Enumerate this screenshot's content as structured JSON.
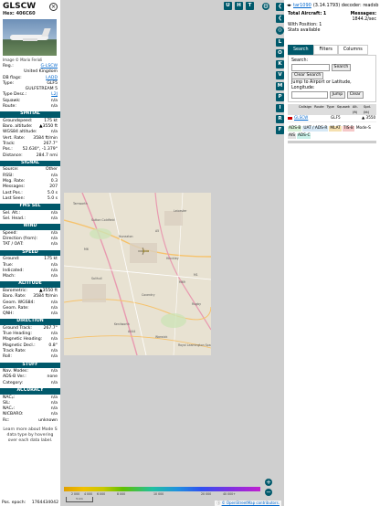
{
  "infoblock": {
    "callsign": "GLSCW",
    "hex_label": "Hex:",
    "hex": "406C60",
    "photo_credit": "Image © Mario Ferioli",
    "basic": [
      {
        "k": "Reg.:",
        "v": "G-LSCW",
        "link": true
      },
      {
        "k": "",
        "v": "United Kingdom",
        "link": false
      },
      {
        "k": "DB flags:",
        "v": "LADD",
        "link": true
      },
      {
        "k": "Type:",
        "v": "GLF5",
        "link": false
      },
      {
        "k": "",
        "v": "GULFSTREAM 5",
        "link": false
      },
      {
        "k": "Type Desc.:",
        "v": "L2J",
        "link": true
      },
      {
        "k": "Squawk:",
        "v": "n/a",
        "link": false
      },
      {
        "k": "Route:",
        "v": "n/a",
        "link": false
      }
    ],
    "spatial_title": "SPATIAL",
    "spatial": [
      {
        "k": "Groundspeed:",
        "v": "175 kt"
      },
      {
        "k": "Baro. altitude:",
        "v": "▲3550 ft"
      },
      {
        "k": "WGS84 altitude:",
        "v": "n/a"
      },
      {
        "k": "Vert. Rate:",
        "v": "3584 ft/min"
      },
      {
        "k": "Track:",
        "v": "267.7°"
      },
      {
        "k": "Pos.:",
        "v": "52.630°, -1.379°"
      },
      {
        "k": "Distance:",
        "v": "284.7 nmi"
      }
    ],
    "signal_title": "SIGNAL",
    "signal": [
      {
        "k": "Source:",
        "v": "Other"
      },
      {
        "k": "RSSI:",
        "v": "n/a"
      },
      {
        "k": "Msg. Rate:",
        "v": "0.3"
      },
      {
        "k": "Messages:",
        "v": "207"
      },
      {
        "k": "Last Pos.:",
        "v": "5.0 s"
      },
      {
        "k": "Last Seen:",
        "v": "5.0 s"
      }
    ],
    "fms_title": "FMS SEL",
    "fms": [
      {
        "k": "Sel. Alt.:",
        "v": "n/a"
      },
      {
        "k": "Sel. Head.:",
        "v": "n/a"
      }
    ],
    "wind_title": "WIND",
    "wind": [
      {
        "k": "Speed:",
        "v": "n/a"
      },
      {
        "k": "Direction (from):",
        "v": "n/a"
      },
      {
        "k": "TAT / OAT:",
        "v": "n/a"
      }
    ],
    "speed_title": "SPEED",
    "speed": [
      {
        "k": "Ground:",
        "v": "175 kt"
      },
      {
        "k": "True:",
        "v": "n/a"
      },
      {
        "k": "Indicated:",
        "v": "n/a"
      },
      {
        "k": "Mach:",
        "v": "n/a"
      }
    ],
    "altitude_title": "ALTITUDE",
    "altitude": [
      {
        "k": "Barometric:",
        "v": "▲3550 ft"
      },
      {
        "k": "Baro. Rate:",
        "v": "3584 ft/min"
      },
      {
        "k": "Geom. WGS84:",
        "v": "n/a"
      },
      {
        "k": "Geom. Rate:",
        "v": "n/a"
      },
      {
        "k": "QNH:",
        "v": "n/a"
      }
    ],
    "direction_title": "DIRECTION",
    "direction": [
      {
        "k": "Ground Track:",
        "v": "267.7°"
      },
      {
        "k": "True Heading:",
        "v": "n/a"
      },
      {
        "k": "Magnetic Heading:",
        "v": "n/a"
      },
      {
        "k": "Magnetic Decl.:",
        "v": "0.8°"
      },
      {
        "k": "Track Rate:",
        "v": "n/a"
      },
      {
        "k": "Roll:",
        "v": "n/a"
      }
    ],
    "stuff_title": "STUFF",
    "stuff": [
      {
        "k": "Nav. Modes:",
        "v": "n/a"
      },
      {
        "k": "ADS-B Ver.:",
        "v": "none"
      },
      {
        "k": "Category:",
        "v": "n/a"
      }
    ],
    "accuracy_title": "ACCURACY",
    "accuracy": [
      {
        "k": "NACₚ:",
        "v": "n/a"
      },
      {
        "k": "SIL:",
        "v": "n/a"
      },
      {
        "k": "NACᵥ:",
        "v": "n/a"
      },
      {
        "k": "NICBARO:",
        "v": "n/a"
      },
      {
        "k": "Rc:",
        "v": "unknown"
      }
    ],
    "footer_note": "Learn more about Mode S data type by hovering over each data label.",
    "pos_epoch_label": "Pos. epoch:",
    "pos_epoch": "1764434042"
  },
  "map": {
    "labels": [
      "Sutton Coldfield",
      "Nuneaton",
      "Coventry",
      "Solihull",
      "Leicester",
      "Royal Leamington Spa",
      "Tamworth",
      "Hinckley",
      "Rugby",
      "Kenilworth",
      "M6",
      "A5",
      "M1",
      "M69",
      "A444",
      "Warwick"
    ],
    "right_buttons": [
      "U",
      "H",
      "T"
    ],
    "side_buttons": [
      "L",
      "O",
      "K",
      "V",
      "M",
      "P",
      "I",
      "R",
      "F"
    ],
    "zoom_in": "+",
    "zoom_out": "−",
    "colorbar_labels": [
      "2 000",
      "4 000",
      "6 000",
      "8 000",
      "10 000",
      "20 000",
      "40 000+"
    ],
    "scale": "5 km",
    "attribution": "© OpenStreetMap contributors."
  },
  "sidebar": {
    "version": "tar1090",
    "version_detail": "(3.14.1793) decoder: readsb",
    "total_label": "Total Aircraft: 1",
    "messages_label": "Messages:",
    "messages_value": "1844.2/sec",
    "with_position_label": "With Position: 1",
    "stats_label": "Stats available",
    "tabs": [
      "Search",
      "Filters",
      "Columns"
    ],
    "search_label": "Search:",
    "search_button": "Search",
    "clear_search_button": "Clear Search",
    "jump_label": "Jump to Airport or Latitude, Longitude:",
    "jump_button": "Jump",
    "clear_button": "Clear",
    "columns": [
      "Callsign",
      "Route",
      "Type",
      "Squawk",
      "Alt. (ft)",
      "Spd. (kt)"
    ],
    "rows": [
      {
        "callsign": "GLSCW",
        "type": "GLF5",
        "alt": "▲ 3550"
      }
    ],
    "badges": [
      {
        "label": "ADS-B",
        "bg": "#d6f0d6"
      },
      {
        "label": "UAT / ADS-R",
        "bg": "#d6e8f5"
      },
      {
        "label": "MLAT",
        "bg": "#f5e0b0"
      },
      {
        "label": "TIS-B",
        "bg": "#f5c8c8"
      },
      {
        "label": "Mode-S",
        "bg": "#ffffff"
      },
      {
        "label": "AIS",
        "bg": "#e0e0e0"
      },
      {
        "label": "ADS-C",
        "bg": "#c8f0e8"
      }
    ]
  }
}
